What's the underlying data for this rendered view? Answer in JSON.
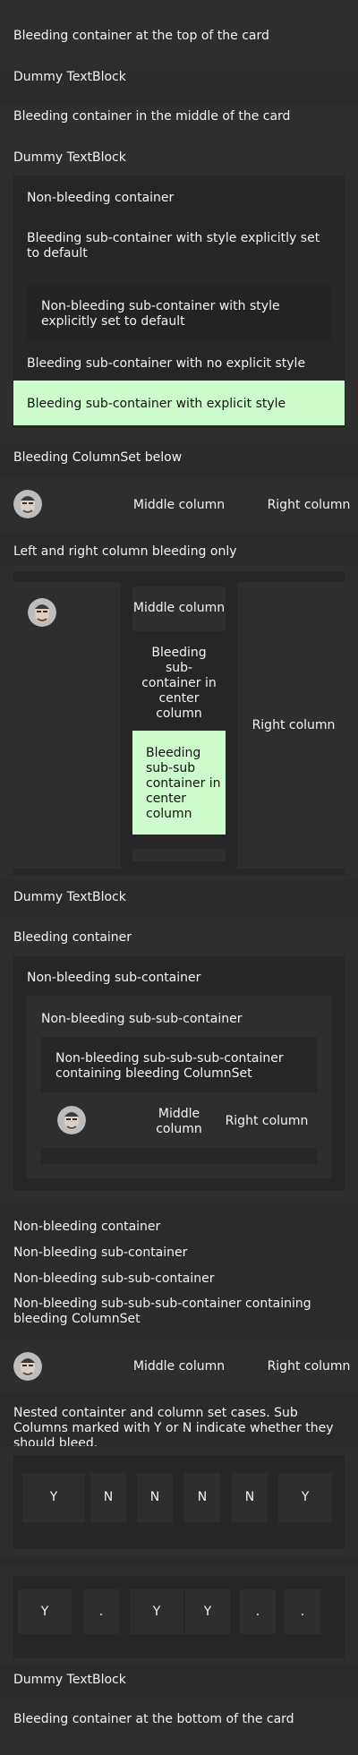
{
  "texts": {
    "t1": "Bleeding container at the top of the card",
    "t2": "Dummy TextBlock",
    "t3": "Bleeding container in the middle of the card",
    "t4": "Dummy TextBlock",
    "t5": "Non-bleeding container",
    "t6": "Bleeding sub-container with style explicitly set to default",
    "t7": "Non-bleeding sub-container with style explicitly set to default",
    "t8": "Bleeding sub-container with no explicit style",
    "t9": "Bleeding sub-container with explicit style",
    "t10": "Bleeding ColumnSet below",
    "t11": "Middle column",
    "t12": "Right column",
    "t13": "Left and right column bleeding only",
    "t14": "Middle column",
    "t15": "Bleeding sub-container in center column",
    "t16": "Bleeding sub-sub container in center column",
    "t17": "Right column",
    "t18": "Dummy TextBlock",
    "t19": "Bleeding container",
    "t20": "Non-bleeding sub-container",
    "t21": "Non-bleeding sub-sub-container",
    "t22": "Non-bleeding sub-sub-sub-container containing bleeding ColumnSet",
    "t23": "Middle column",
    "t24": "Right column",
    "t25": "Non-bleeding container",
    "t26": "Non-bleeding sub-container",
    "t27": "Non-bleeding sub-sub-container",
    "t28": "Non-bleeding sub-sub-sub-container containing bleeding ColumnSet",
    "t29": "Middle column",
    "t30": "Right column",
    "t31": "Nested containter and column set cases. Sub Columns marked with Y or N indicate whether they should bleed.",
    "t32": "Dummy TextBlock",
    "t33": "Bleeding container at the bottom of the card"
  },
  "row1": [
    "Y",
    "N",
    "N",
    "N",
    "N",
    "Y"
  ],
  "row2": [
    "Y",
    ".",
    "Y",
    "Y",
    ".",
    "."
  ],
  "colors": {
    "background": "#2b2b2b",
    "emphasis": "#2e2e2e",
    "accent_green": "#ccfbcc"
  },
  "icons": {
    "avatar": "person-avatar-icon"
  }
}
